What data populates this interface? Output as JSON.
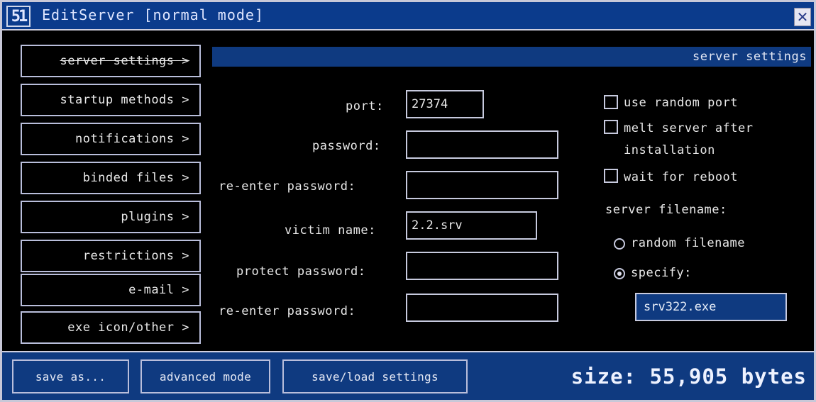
{
  "window": {
    "title": "EditServer [normal mode]",
    "logo_glyph": "51",
    "close_glyph": "✕"
  },
  "sidebar": {
    "items": [
      {
        "label": "server settings >",
        "active": true
      },
      {
        "label": "startup methods >"
      },
      {
        "label": "notifications >"
      },
      {
        "label": "binded files >"
      },
      {
        "label": "plugins >"
      },
      {
        "label": "restrictions >"
      },
      {
        "label": "e-mail >"
      },
      {
        "label": "exe icon/other >"
      }
    ]
  },
  "section_header": "server settings",
  "form": {
    "port_label": "port:",
    "port_value": "27374",
    "password_label": "password:",
    "password_value": "",
    "reenter_label": "re-enter password:",
    "reenter_value": "",
    "victim_label": "victim name:",
    "victim_value": "2.2.srv",
    "protect_label": "protect password:",
    "protect_value": "",
    "reenter2_label": "re-enter password:",
    "reenter2_value": ""
  },
  "options": {
    "random_port_label": "use random port",
    "random_port_checked": false,
    "melt_label_line1": "melt server after",
    "melt_label_line2": "installation",
    "melt_checked": false,
    "wait_reboot_label": "wait for reboot",
    "wait_reboot_checked": false,
    "filename_heading": "server filename:",
    "random_filename_label": "random filename",
    "specify_label": "specify:",
    "selected_radio": "specify",
    "filename_value": "srv322.exe"
  },
  "footer": {
    "save_as_label": "save as...",
    "advanced_label": "advanced mode",
    "save_load_label": "save/load settings",
    "size_text": "size: 55,905 bytes"
  },
  "colors": {
    "accent_blue": "#0f3a80",
    "title_blue": "#0b3b8c",
    "border": "#c7cade"
  }
}
